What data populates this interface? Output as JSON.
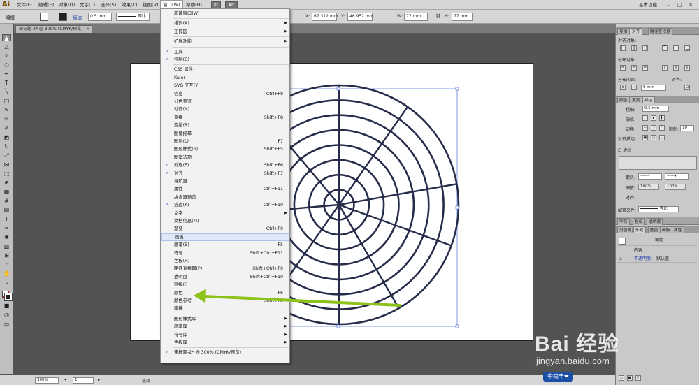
{
  "app": {
    "logo": "Ai"
  },
  "menubar": {
    "items": [
      "文件(F)",
      "编辑(E)",
      "对象(O)",
      "文字(T)",
      "选择(S)",
      "效果(C)",
      "视图(V)",
      "窗口(W)",
      "帮助(H)"
    ],
    "workspace": "基本功能",
    "bridge_icon": "Br"
  },
  "controlbar": {
    "selection_label": "编组",
    "stroke_label": "描边",
    "stroke_value": "0.5 mm",
    "stroke_style": "等比",
    "x_value": "67.312 mm",
    "y_value": "46.952 mm",
    "w_value": "77 mm",
    "h_value": "77 mm"
  },
  "document": {
    "tab_title": "未标题-2* @ 300% (CMYK/预览)",
    "close": "×"
  },
  "window_menu": {
    "items": [
      {
        "label": "新建窗口(W)",
        "shortcut": "",
        "checked": false,
        "submenu": false
      },
      {
        "sep": true
      },
      {
        "label": "排列(A)",
        "shortcut": "",
        "checked": false,
        "submenu": true
      },
      {
        "label": "工作区",
        "shortcut": "",
        "checked": false,
        "submenu": true
      },
      {
        "sep": true
      },
      {
        "label": "扩展功能",
        "shortcut": "",
        "checked": false,
        "submenu": true
      },
      {
        "sep": true
      },
      {
        "label": "工具",
        "shortcut": "",
        "checked": true,
        "submenu": false
      },
      {
        "label": "控制(C)",
        "shortcut": "",
        "checked": true,
        "submenu": false
      },
      {
        "sep": true
      },
      {
        "label": "CSS 属性",
        "shortcut": "",
        "checked": false,
        "submenu": false
      },
      {
        "label": "Kuler",
        "shortcut": "",
        "checked": false,
        "submenu": false
      },
      {
        "label": "SVG 交互(Y)",
        "shortcut": "",
        "checked": false,
        "submenu": false
      },
      {
        "label": "信息",
        "shortcut": "Ctrl+F8",
        "checked": false,
        "submenu": false
      },
      {
        "label": "分色预览",
        "shortcut": "",
        "checked": false,
        "submenu": false
      },
      {
        "label": "动作(N)",
        "shortcut": "",
        "checked": false,
        "submenu": false
      },
      {
        "label": "变换",
        "shortcut": "Shift+F8",
        "checked": false,
        "submenu": false
      },
      {
        "label": "变量(R)",
        "shortcut": "",
        "checked": false,
        "submenu": false
      },
      {
        "label": "图像描摹",
        "shortcut": "",
        "checked": false,
        "submenu": false
      },
      {
        "label": "图层(L)",
        "shortcut": "F7",
        "checked": false,
        "submenu": false
      },
      {
        "label": "图形样式(S)",
        "shortcut": "Shift+F5",
        "checked": false,
        "submenu": false
      },
      {
        "label": "图案选项",
        "shortcut": "",
        "checked": false,
        "submenu": false
      },
      {
        "label": "外观(E)",
        "shortcut": "Shift+F6",
        "checked": true,
        "submenu": false
      },
      {
        "label": "对齐",
        "shortcut": "Shift+F7",
        "checked": true,
        "submenu": false
      },
      {
        "label": "导航器",
        "shortcut": "",
        "checked": false,
        "submenu": false
      },
      {
        "label": "属性",
        "shortcut": "Ctrl+F11",
        "checked": false,
        "submenu": false
      },
      {
        "label": "拼合器预览",
        "shortcut": "",
        "checked": false,
        "submenu": false
      },
      {
        "label": "描边(K)",
        "shortcut": "Ctrl+F10",
        "checked": true,
        "submenu": false
      },
      {
        "label": "文字",
        "shortcut": "",
        "checked": false,
        "submenu": true
      },
      {
        "label": "文档信息(M)",
        "shortcut": "",
        "checked": false,
        "submenu": false
      },
      {
        "label": "渐变",
        "shortcut": "Ctrl+F9",
        "checked": false,
        "submenu": false
      },
      {
        "label": "画板",
        "shortcut": "",
        "checked": false,
        "submenu": false,
        "hover": true
      },
      {
        "label": "画笔(B)",
        "shortcut": "F5",
        "checked": false,
        "submenu": false
      },
      {
        "label": "符号",
        "shortcut": "Shift+Ctrl+F11",
        "checked": false,
        "submenu": false
      },
      {
        "label": "色板(H)",
        "shortcut": "",
        "checked": false,
        "submenu": false
      },
      {
        "label": "路径查找器(P)",
        "shortcut": "Shift+Ctrl+F9",
        "checked": false,
        "submenu": false
      },
      {
        "label": "透明度",
        "shortcut": "Shift+Ctrl+F10",
        "checked": false,
        "submenu": false
      },
      {
        "label": "链接(I)",
        "shortcut": "",
        "checked": false,
        "submenu": false
      },
      {
        "label": "颜色",
        "shortcut": "F6",
        "checked": false,
        "submenu": false
      },
      {
        "label": "颜色参考",
        "shortcut": "Shift+F3",
        "checked": false,
        "submenu": false
      },
      {
        "label": "魔棒",
        "shortcut": "",
        "checked": false,
        "submenu": false
      },
      {
        "sep": true
      },
      {
        "label": "图形样式库",
        "shortcut": "",
        "checked": false,
        "submenu": true
      },
      {
        "label": "画笔库",
        "shortcut": "",
        "checked": false,
        "submenu": true
      },
      {
        "label": "符号库",
        "shortcut": "",
        "checked": false,
        "submenu": true
      },
      {
        "label": "色板库",
        "shortcut": "",
        "checked": false,
        "submenu": true
      },
      {
        "sep": true
      },
      {
        "label": "未标题-2* @ 300% (CMYK/预览)",
        "shortcut": "",
        "checked": true,
        "submenu": false
      }
    ]
  },
  "panels": {
    "align": {
      "tabs": [
        "变换",
        "对齐",
        "路径查找器"
      ],
      "align_objects": "对齐对象:",
      "distribute_objects": "分布对象:",
      "distribute_spacing": "分布间距:",
      "align_to": "对齐:",
      "spacing_value": "0 mm"
    },
    "stroke": {
      "tabs": [
        "颜色",
        "渐变",
        "描边"
      ],
      "weight_label": "粗细:",
      "weight_value": "0.5 mm",
      "cap_label": "端点:",
      "corner_label": "边角:",
      "limit_label": "限制:",
      "limit_value": "10",
      "align_label": "对齐描边:",
      "dashed_label": "虚线",
      "arrows_label": "箭头:",
      "scale_label": "缩放:",
      "scale1": "100%",
      "scale2": "100%",
      "align2_label": "对齐:",
      "profile_label": "配置文件:",
      "profile_value": "等比"
    },
    "appearance": {
      "tabs_top": [
        "字符",
        "色板",
        "透明度"
      ],
      "tabs": [
        "分色预览",
        "外观",
        "图层",
        "画板",
        "属性"
      ],
      "group_label": "编组",
      "contents_label": "内容",
      "opacity_label": "不透明度:",
      "opacity_value": "默认值"
    }
  },
  "statusbar": {
    "zoom": "300%",
    "artboard": "1",
    "tool": "选择"
  },
  "watermark": {
    "main": "Bai 经验",
    "sub": "jingyan.baidu.com",
    "badge": "中简丰❤"
  },
  "colors": {
    "artwork_stroke": "#262c4a",
    "selection": "#4f6fd9",
    "arrow": "#8cc21a"
  },
  "artwork": {
    "ring_count": 8,
    "spoke_count": 9
  }
}
